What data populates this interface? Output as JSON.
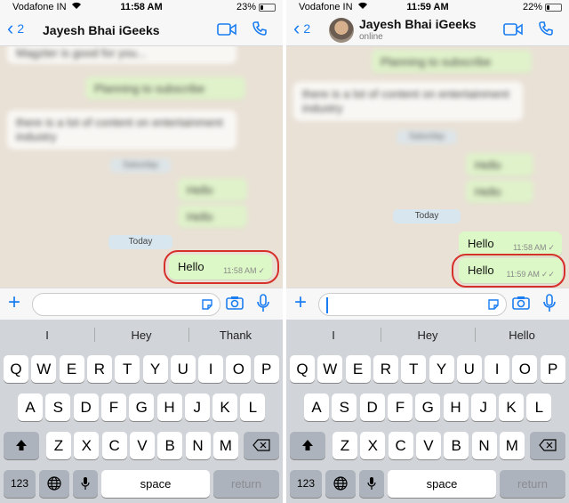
{
  "left": {
    "status": {
      "carrier": "Vodafone IN",
      "time": "11:58 AM",
      "battery": "23%",
      "battery_level": 0.23
    },
    "header": {
      "back_count": "2",
      "contact_name": "Jayesh Bhai iGeeks"
    },
    "messages": {
      "m1": "Magzter is good for you...",
      "m2": "Planning to subscribe",
      "m3_line1": "there is a lot of content on entertainment",
      "m3_line2": "industry",
      "day1": "Saturday",
      "m4": "Hello",
      "m5": "Hello",
      "day2": "Today",
      "m6": "Hello",
      "m6_time": "11:58 AM"
    },
    "suggestions": [
      "I",
      "Hey",
      "Thank"
    ]
  },
  "right": {
    "status": {
      "carrier": "Vodafone IN",
      "time": "11:59 AM",
      "battery": "22%",
      "battery_level": 0.22
    },
    "header": {
      "back_count": "2",
      "contact_name": "Jayesh Bhai iGeeks",
      "presence": "online"
    },
    "messages": {
      "m1": "Planning to subscribe",
      "m2_line1": "there is a lot of content on entertainment",
      "m2_line2": "industry",
      "day1": "Saturday",
      "m3": "Hello",
      "m4": "Hello",
      "day2": "Today",
      "m5": "Hello",
      "m5_time": "11:58 AM",
      "m6": "Hello",
      "m6_time": "11:59 AM"
    },
    "suggestions": [
      "I",
      "Hey",
      "Hello"
    ]
  },
  "keyboard": {
    "row1": [
      "Q",
      "W",
      "E",
      "R",
      "T",
      "Y",
      "U",
      "I",
      "O",
      "P"
    ],
    "row2": [
      "A",
      "S",
      "D",
      "F",
      "G",
      "H",
      "J",
      "K",
      "L"
    ],
    "row3": [
      "Z",
      "X",
      "C",
      "V",
      "B",
      "N",
      "M"
    ],
    "numbers_key": "123",
    "space_key": "space",
    "return_key": "return"
  },
  "colors": {
    "accent": "#1a7df1",
    "outgoing_bubble": "#dcf8c6",
    "highlight_ring": "#d5302a",
    "chat_bg": "#e9e1d6"
  }
}
